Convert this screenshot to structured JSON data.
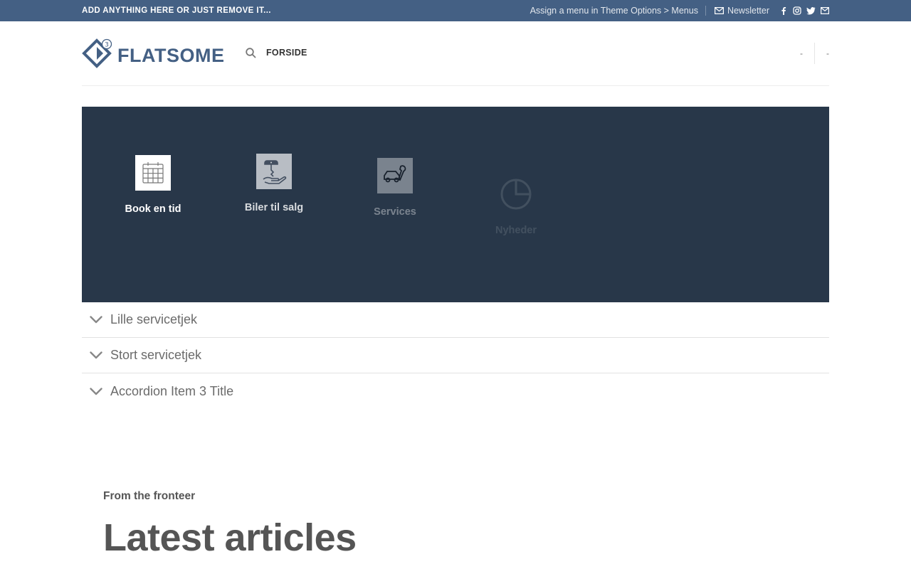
{
  "topbar": {
    "left_text": "ADD ANYTHING HERE OR JUST REMOVE IT...",
    "menu_hint": "Assign a menu in Theme Options > Menus",
    "newsletter_label": "Newsletter",
    "social_icons": [
      "facebook-icon",
      "instagram-icon",
      "twitter-icon",
      "email-icon"
    ]
  },
  "header": {
    "logo_badge": "3",
    "logo_text": "FLATSOME",
    "nav_home": "FORSIDE",
    "right_items": [
      "-",
      "-"
    ]
  },
  "features": [
    {
      "label": "Book en tid",
      "icon": "calendar-icon"
    },
    {
      "label": "Biler til salg",
      "icon": "car-key-hand-icon"
    },
    {
      "label": "Services",
      "icon": "car-wrench-icon"
    },
    {
      "label": "Nyheder",
      "icon": "pie-chart-icon"
    }
  ],
  "accordion": {
    "items": [
      {
        "title": "Lille servicetjek"
      },
      {
        "title": "Stort servicetjek"
      },
      {
        "title": "Accordion Item 3 Title"
      }
    ]
  },
  "articles": {
    "kicker": "From the fronteer",
    "title": "Latest articles"
  },
  "colors": {
    "topbar": "#446084",
    "panel": "#283749",
    "text_muted": "#6b6b6b"
  }
}
